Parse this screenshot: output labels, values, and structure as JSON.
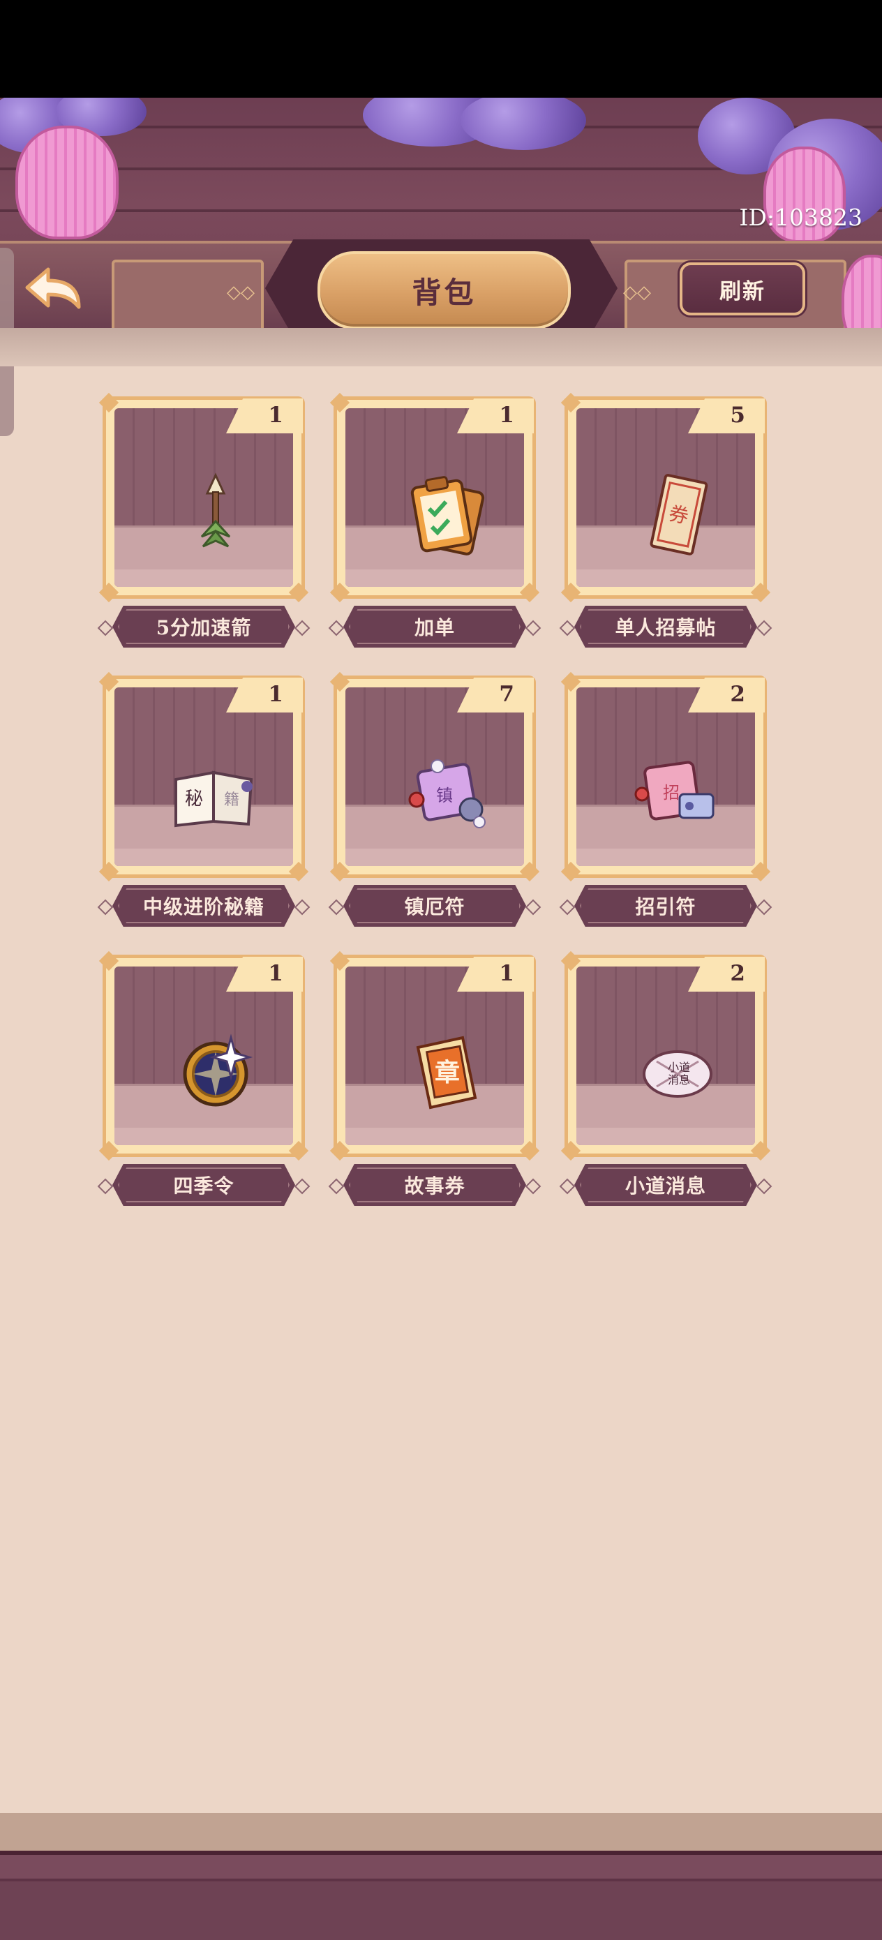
{
  "header": {
    "title": "背包",
    "player_id": "ID:103823",
    "refresh_label": "刷新",
    "back_icon": "curved-back-arrow"
  },
  "colors": {
    "background": "#ecd6c7",
    "header_wood": "#7c4a5c",
    "frame_gold": "#e8b474",
    "ribbon": "#6a3f52",
    "title_plate": "#d9a066"
  },
  "inventory": {
    "items": [
      {
        "name": "5分加速箭",
        "count": "1",
        "icon": "arrow-icon"
      },
      {
        "name": "加单",
        "count": "1",
        "icon": "clipboard-icon"
      },
      {
        "name": "单人招募帖",
        "count": "5",
        "icon": "ticket-icon"
      },
      {
        "name": "中级进阶秘籍",
        "count": "1",
        "icon": "book-icon"
      },
      {
        "name": "镇厄符",
        "count": "7",
        "icon": "talisman-icon"
      },
      {
        "name": "招引符",
        "count": "2",
        "icon": "charm-icon"
      },
      {
        "name": "四季令",
        "count": "1",
        "icon": "compass-icon"
      },
      {
        "name": "故事券",
        "count": "1",
        "icon": "scroll-icon"
      },
      {
        "name": "小道消息",
        "count": "2",
        "icon": "rumor-note-icon"
      }
    ]
  }
}
